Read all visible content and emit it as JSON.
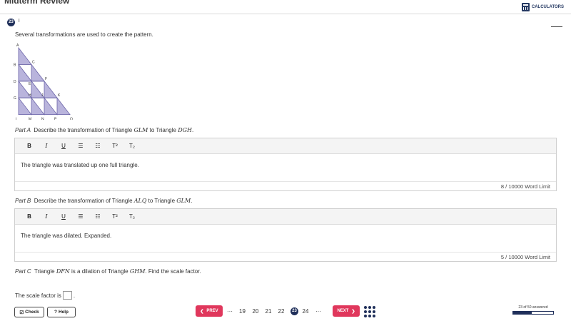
{
  "header": {
    "title": "Midterm Review",
    "calculators_label": "CALCULATORS"
  },
  "question": {
    "number": "23",
    "info_icon": "i",
    "prompt": "Several transformations are used to create the pattern."
  },
  "figure": {
    "vertex_labels": [
      "A",
      "B",
      "C",
      "D",
      "E",
      "F",
      "G",
      "H",
      "J",
      "K",
      "L",
      "M",
      "N",
      "P",
      "Q"
    ]
  },
  "parts": {
    "a": {
      "label": "Part A",
      "text_before": "Describe the transformation of Triangle",
      "tri1": "GLM",
      "text_mid": "to Triangle",
      "tri2": "DGH",
      "text_after": ".",
      "answer": "The triangle was translated up one full triangle.",
      "word_count": "8 / 10000 Word Limit"
    },
    "b": {
      "label": "Part B",
      "text_before": "Describe the transformation of Triangle",
      "tri1": "ALQ",
      "text_mid": "to Triangle",
      "tri2": "GLM",
      "text_after": ".",
      "answer": "The triangle was dilated. Expanded.",
      "word_count": "5 / 10000 Word Limit"
    },
    "c": {
      "label": "Part C",
      "text_before": "Triangle",
      "tri1": "DFN",
      "text_mid": "is a dilation of Triangle",
      "tri2": "GHM",
      "text_after": ". Find the scale factor.",
      "scale_text": "The scale factor is",
      "scale_suffix": "."
    }
  },
  "toolbar": {
    "bold": "B",
    "italic": "I",
    "underline": "U",
    "bullets": "☰",
    "numbered": "☷",
    "superscript": "T²",
    "subscript": "T₂"
  },
  "footer": {
    "check_label": "Check",
    "help_label": "Help",
    "prev_label": "PREV",
    "next_label": "NEXT",
    "ellipsis": "···",
    "pages": [
      "19",
      "20",
      "21",
      "22",
      "23",
      "24"
    ],
    "current_page": "23",
    "progress_text": "23 of 50 answered",
    "progress_fraction": 0.46
  },
  "colors": {
    "accent": "#1f2f5a",
    "nav_button": "#e0375c",
    "triangle_fill": "#b9b4dc",
    "triangle_stroke": "#6b64a8"
  }
}
